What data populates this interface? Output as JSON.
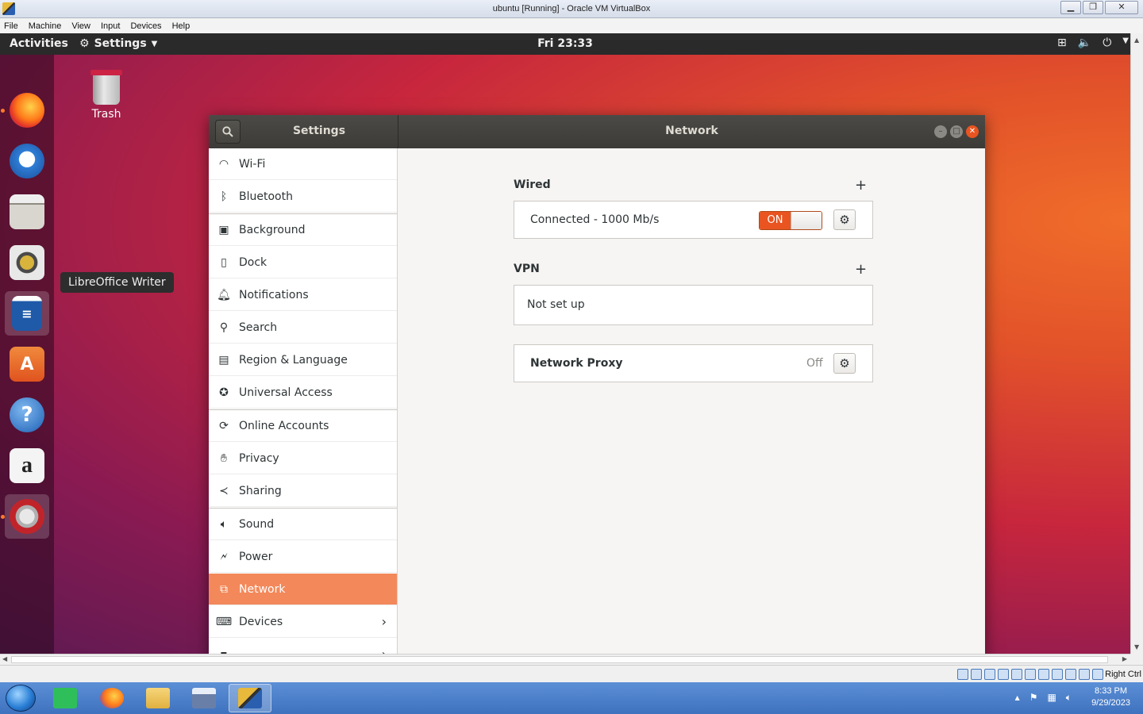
{
  "host": {
    "title": "ubuntu [Running] - Oracle VM VirtualBox",
    "menu": [
      "File",
      "Machine",
      "View",
      "Input",
      "Devices",
      "Help"
    ],
    "host_key": "Right Ctrl",
    "clock_time": "8:33 PM",
    "clock_date": "9/29/2023"
  },
  "topbar": {
    "activities": "Activities",
    "app_menu": "Settings",
    "clock": "Fri 23:33"
  },
  "dock": {
    "tooltip": "LibreOffice Writer",
    "items": [
      "firefox-icon",
      "thunderbird-icon",
      "files-icon",
      "rhythmbox-icon",
      "libreoffice-writer-icon",
      "software-center-icon",
      "help-icon",
      "amazon-icon",
      "settings-icon"
    ]
  },
  "desktop": {
    "trash_label": "Trash"
  },
  "settings": {
    "sidebar_title": "Settings",
    "panel_title": "Network",
    "sidebar": [
      {
        "label": "Wi-Fi",
        "icon": "wifi-icon"
      },
      {
        "label": "Bluetooth",
        "icon": "bluetooth-icon"
      },
      {
        "label": "Background",
        "icon": "background-icon"
      },
      {
        "label": "Dock",
        "icon": "dock-icon"
      },
      {
        "label": "Notifications",
        "icon": "bell-icon"
      },
      {
        "label": "Search",
        "icon": "search-icon"
      },
      {
        "label": "Region & Language",
        "icon": "region-icon"
      },
      {
        "label": "Universal Access",
        "icon": "accessibility-icon"
      },
      {
        "label": "Online Accounts",
        "icon": "online-accounts-icon"
      },
      {
        "label": "Privacy",
        "icon": "hand-icon"
      },
      {
        "label": "Sharing",
        "icon": "share-icon"
      },
      {
        "label": "Sound",
        "icon": "speaker-icon"
      },
      {
        "label": "Power",
        "icon": "power-icon"
      },
      {
        "label": "Network",
        "icon": "network-icon"
      },
      {
        "label": "Devices",
        "icon": "devices-icon"
      }
    ],
    "network": {
      "wired_title": "Wired",
      "wired_status": "Connected - 1000 Mb/s",
      "wired_switch": "ON",
      "vpn_title": "VPN",
      "vpn_status": "Not set up",
      "proxy_label": "Network Proxy",
      "proxy_value": "Off"
    }
  }
}
